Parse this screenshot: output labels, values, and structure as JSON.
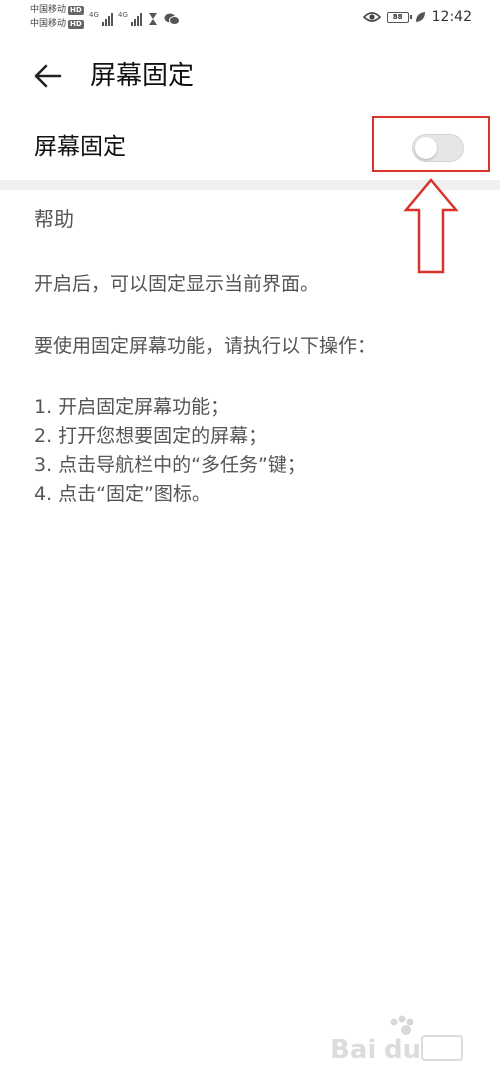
{
  "status_bar": {
    "carrier1": "中国移动",
    "carrier2": "中国移动",
    "hd_badge": "HD",
    "net1": "4G",
    "net2": "4G",
    "battery": "88",
    "time": "12:42",
    "icons": [
      "signal-icon",
      "hourglass-icon",
      "wechat-icon",
      "eye-icon",
      "battery-icon",
      "leaf-icon"
    ]
  },
  "header": {
    "title": "屏幕固定",
    "back_icon": "back-arrow-icon"
  },
  "setting": {
    "label": "屏幕固定",
    "toggle_on": false
  },
  "help": {
    "title": "帮助",
    "p1": "开启后，可以固定显示当前界面。",
    "p2": "要使用固定屏幕功能，请执行以下操作：",
    "steps": [
      "1. 开启固定屏幕功能；",
      "2. 打开您想要固定的屏幕；",
      "3. 点击导航栏中的“多任务”键；",
      "4. 点击“固定”图标。"
    ]
  },
  "colors": {
    "annotation_red": "#d9342b",
    "toggle_off": "#e6e6e6",
    "divider": "#f0f0f0"
  }
}
